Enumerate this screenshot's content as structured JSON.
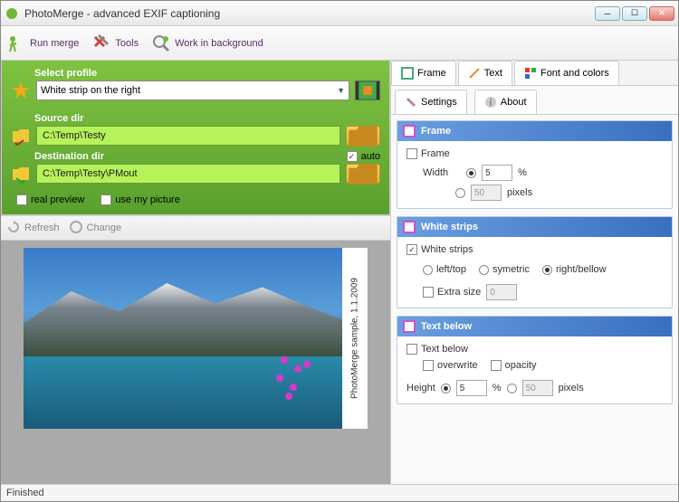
{
  "window": {
    "title": "PhotoMerge - advanced EXIF captioning"
  },
  "toolbar": {
    "run_merge": "Run merge",
    "tools": "Tools",
    "work_bg": "Work in background"
  },
  "profile": {
    "label": "Select profile",
    "value": "White strip on the right"
  },
  "source": {
    "label": "Source dir",
    "value": "C:\\Temp\\Testy"
  },
  "dest": {
    "label": "Destination dir",
    "value": "C:\\Temp\\Testy\\PMout",
    "auto_label": "auto",
    "auto_checked": true
  },
  "options": {
    "real_preview": "real preview",
    "use_my_picture": "use my picture"
  },
  "secondbar": {
    "refresh": "Refresh",
    "change": "Change"
  },
  "preview": {
    "caption": "PhotoMerge sample, 1.1.2009"
  },
  "tabs": {
    "frame": "Frame",
    "text": "Text",
    "font_colors": "Font and colors",
    "settings": "Settings",
    "about": "About"
  },
  "panel_frame": {
    "title": "Frame",
    "chk": "Frame",
    "width_label": "Width",
    "width_value": "5",
    "percent": "%",
    "pixels_value": "50",
    "pixels": "pixels"
  },
  "panel_strips": {
    "title": "White strips",
    "chk": "White strips",
    "left_top": "left/top",
    "symetric": "symetric",
    "right_bellow": "right/bellow",
    "extra": "Extra size",
    "extra_value": "0"
  },
  "panel_text": {
    "title": "Text below",
    "chk": "Text below",
    "overwrite": "overwrite",
    "opacity": "opacity",
    "height_label": "Height",
    "height_value": "5",
    "percent": "%",
    "pixels_value": "50",
    "pixels": "pixels"
  },
  "status": {
    "text": "Finished"
  }
}
